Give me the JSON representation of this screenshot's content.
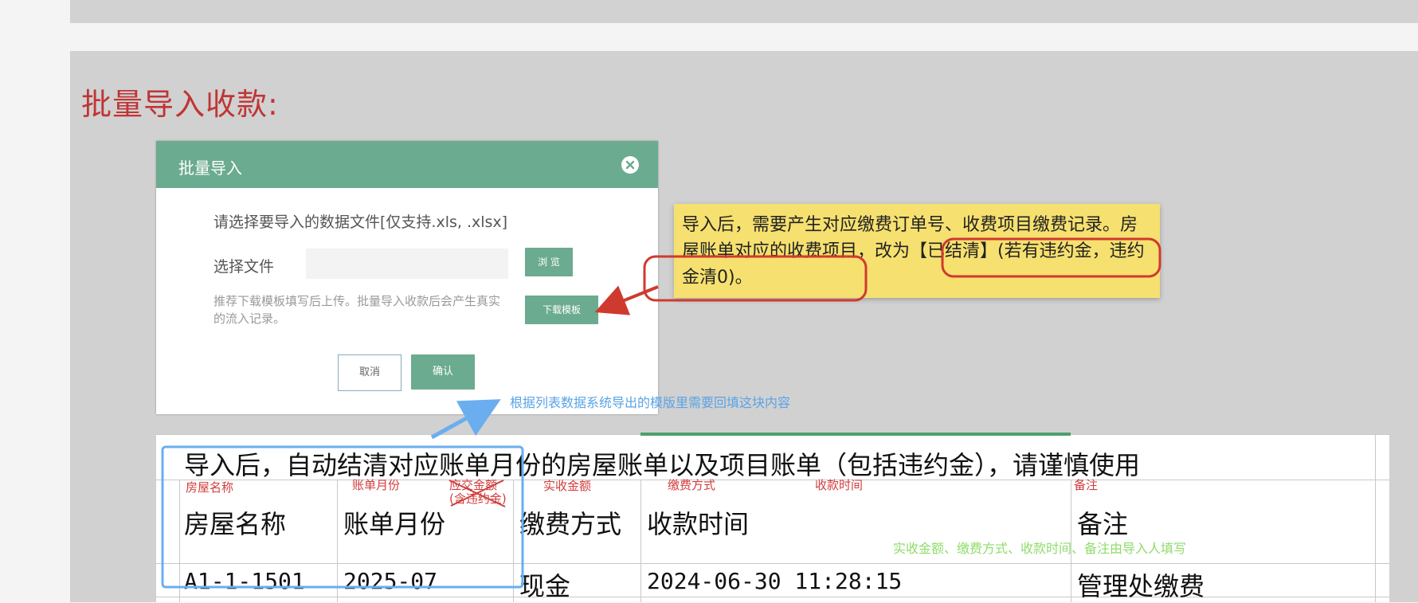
{
  "page": {
    "section_title": "批量导入收款:"
  },
  "dialog": {
    "title": "批量导入",
    "hint": "请选择要导入的数据文件[仅支持.xls, .xlsx]",
    "file_label": "选择文件",
    "file_value": "",
    "browse_label": "浏 览",
    "download_label": "下载模板",
    "note": "推荐下载模板填写后上传。批量导入收款后会产生真实的流入记录。",
    "cancel_label": "取消",
    "confirm_label": "确认"
  },
  "annotations": {
    "yellow_note": "导入后，需要产生对应缴费订单号、收费项目缴费记录。房屋账单对应的收费项目，改为【已结清】(若有违约金，违约金清0)。",
    "blue_caption": "根据列表数据系统导出的模版里需要回填这块内容",
    "green_caption": "实收金额、缴费方式、收款时间、备注由导入人填写",
    "red_labels": [
      "房屋名称",
      "账单月份",
      "应交金额",
      "(含违约金)",
      "实收金额",
      "缴费方式",
      "收款时间",
      "备注"
    ]
  },
  "sheet": {
    "banner": "导入后，自动结清对应账单月份的房屋账单以及项目账单（包括违约金），请谨慎使用",
    "headers": [
      "房屋名称",
      "账单月份",
      "缴费方式",
      "收款时间",
      "备注"
    ],
    "row": [
      "A1-1-1501",
      "2025-07",
      "现金",
      "2024-06-30 11:28:15",
      "管理处缴费"
    ]
  },
  "colors": {
    "dialog_green": "#6bab8f",
    "title_red": "#c03535",
    "note_yellow": "#f6e06f",
    "annotation_blue": "#5aa3e6",
    "annotation_green": "#8fdc6b"
  }
}
